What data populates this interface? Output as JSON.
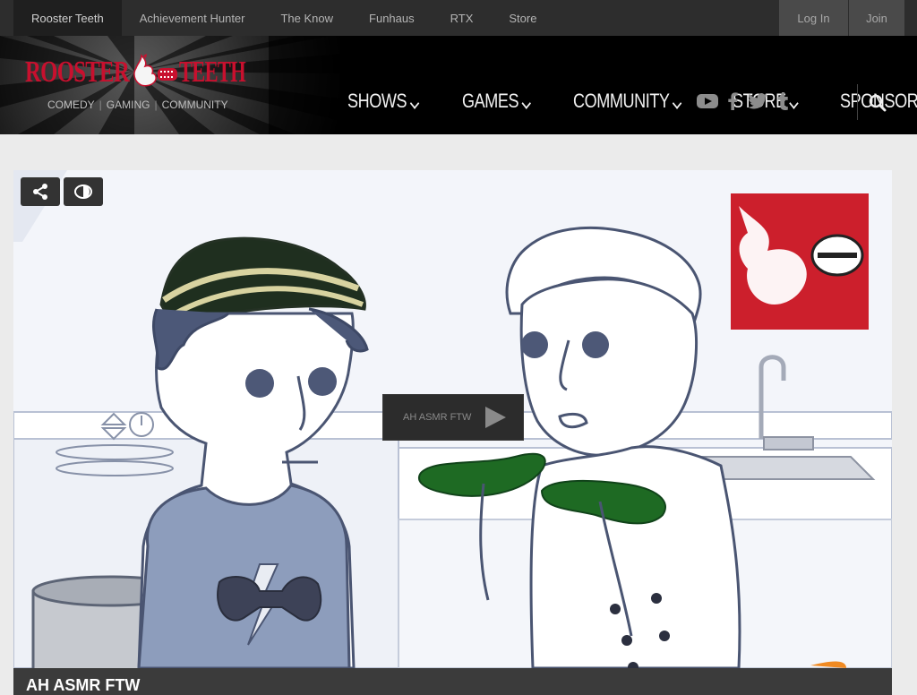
{
  "topbar": {
    "network": [
      {
        "label": "Rooster Teeth",
        "active": true
      },
      {
        "label": "Achievement Hunter"
      },
      {
        "label": "The Know"
      },
      {
        "label": "Funhaus"
      },
      {
        "label": "RTX"
      },
      {
        "label": "Store"
      }
    ],
    "login_label": "Log In",
    "join_label": "Join"
  },
  "header": {
    "logo_text": "ROOSTER TEETH",
    "tagline": [
      "COMEDY",
      "GAMING",
      "COMMUNITY"
    ],
    "tagline_sep": "|",
    "nav": [
      {
        "label": "SHOWS",
        "dropdown": true
      },
      {
        "label": "GAMES",
        "dropdown": true
      },
      {
        "label": "COMMUNITY",
        "dropdown": true
      },
      {
        "label": "STORE",
        "dropdown": true
      },
      {
        "label": "SPONSOR",
        "star": true
      }
    ],
    "social_icons": [
      "youtube-icon",
      "facebook-icon",
      "twitter-icon",
      "tumblr-icon"
    ],
    "search_icon": "search-icon"
  },
  "video": {
    "play_label": "AH ASMR FTW",
    "title": "AH ASMR FTW"
  },
  "colors": {
    "brand_red": "#c8102e",
    "star": "#d9c72a",
    "topbar_bg": "#2d2d2d",
    "header_bg": "#000000"
  }
}
